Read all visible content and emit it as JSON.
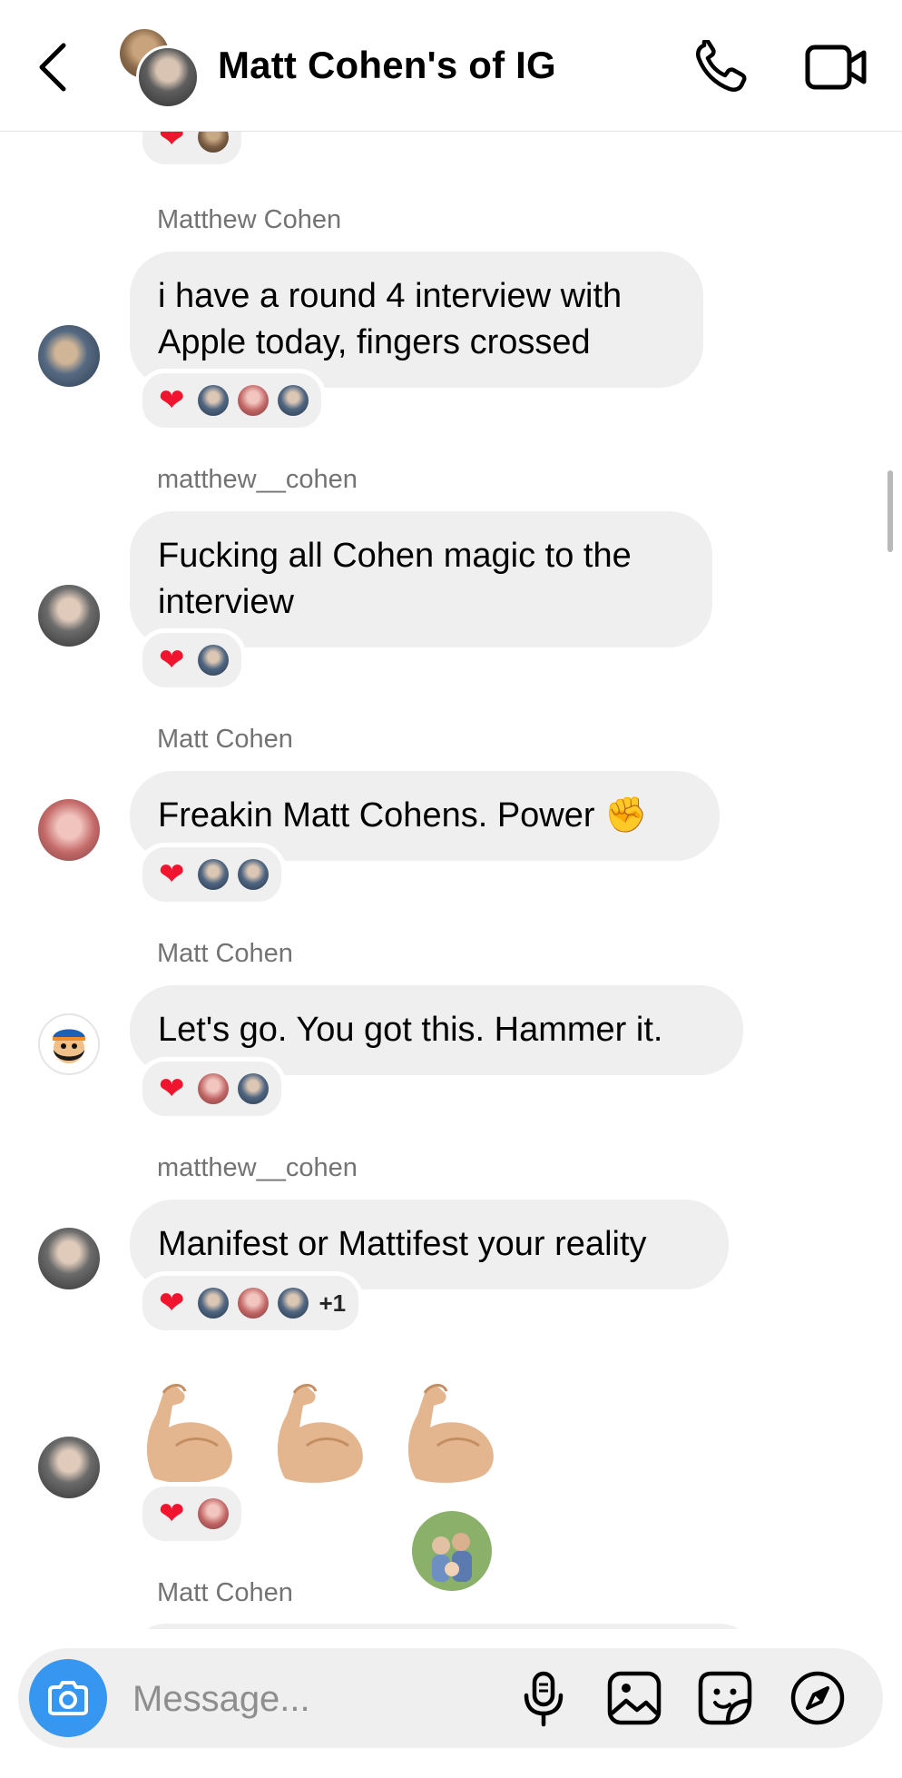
{
  "header": {
    "title": "Matt Cohen's of IG"
  },
  "messages": [
    {
      "sender": "Matthew Cohen",
      "text": "i have a round 4 interview with Apple today, fingers crossed",
      "reactions": {
        "heart": "❤",
        "count_extra": ""
      }
    },
    {
      "sender": "matthew__cohen",
      "text": "Fucking all Cohen magic to the interview",
      "reactions": {
        "heart": "❤"
      }
    },
    {
      "sender": "Matt Cohen",
      "text": "Freakin Matt Cohens. Power ✊",
      "reactions": {
        "heart": "❤"
      }
    },
    {
      "sender": "Matt Cohen",
      "text": "Let's go. You got this. Hammer it.",
      "reactions": {
        "heart": "❤"
      }
    },
    {
      "sender": "matthew__cohen",
      "text": "Manifest or Mattifest your reality",
      "reactions": {
        "heart": "❤",
        "extra": "+1"
      }
    },
    {
      "sender": "",
      "text": "",
      "reactions": {
        "heart": "❤"
      }
    },
    {
      "sender": "Matt Cohen",
      "text": ""
    }
  ],
  "top_reaction": {
    "heart": "❤"
  },
  "composer": {
    "placeholder": "Message..."
  },
  "icons": {
    "back": "chevron-left-icon",
    "call": "phone-icon",
    "video": "video-camera-icon",
    "camera": "camera-icon",
    "mic": "microphone-icon",
    "gallery": "image-icon",
    "sticker": "sticker-icon",
    "explore": "compass-icon"
  },
  "colors": {
    "accent": "#3797f0",
    "bubble": "#efefef",
    "heart": "#f0142f",
    "sender": "#737373"
  }
}
